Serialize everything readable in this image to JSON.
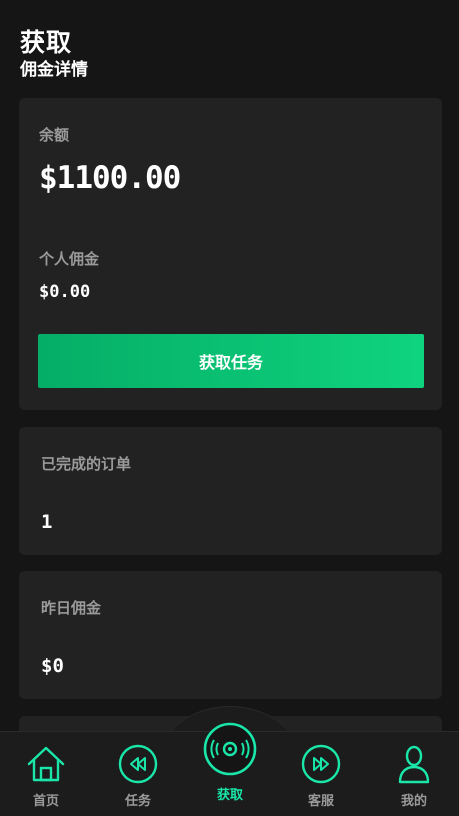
{
  "header": {
    "title": "获取",
    "subtitle": "佣金详情"
  },
  "balance": {
    "label": "余额",
    "value": "$1100.00",
    "commission_label": "个人佣金",
    "commission_value": "$0.00",
    "button_label": "获取任务"
  },
  "stats": [
    {
      "label": "已完成的订单",
      "value": "1"
    },
    {
      "label": "昨日佣金",
      "value": "$0"
    }
  ],
  "nav": {
    "items": [
      {
        "label": "首页",
        "icon": "home-icon"
      },
      {
        "label": "任务",
        "icon": "rewind-icon"
      },
      {
        "label": "获取",
        "icon": "disc-icon",
        "active": true
      },
      {
        "label": "客服",
        "icon": "fast-forward-icon"
      },
      {
        "label": "我的",
        "icon": "user-icon"
      }
    ]
  },
  "colors": {
    "accent": "#19e6a8",
    "button_gradient_start": "#05ad66",
    "button_gradient_end": "#0fd47f",
    "background": "#151515",
    "card": "#222222"
  }
}
